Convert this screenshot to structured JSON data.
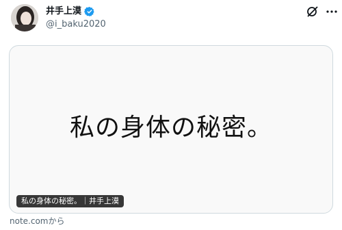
{
  "tweet": {
    "author_name": "井手上漠",
    "handle": "@i_baku2020",
    "verified": true
  },
  "card": {
    "headline": "私の身体の秘密。",
    "caption": "私の身体の秘密。｜井手上漠",
    "source": "note.comから"
  },
  "colors": {
    "verified_badge": "#1d9bf0",
    "secondary_text": "#536471",
    "card_border": "#cfd9de"
  },
  "icons": [
    "grok-icon",
    "more-options-icon",
    "verified-badge-icon"
  ]
}
